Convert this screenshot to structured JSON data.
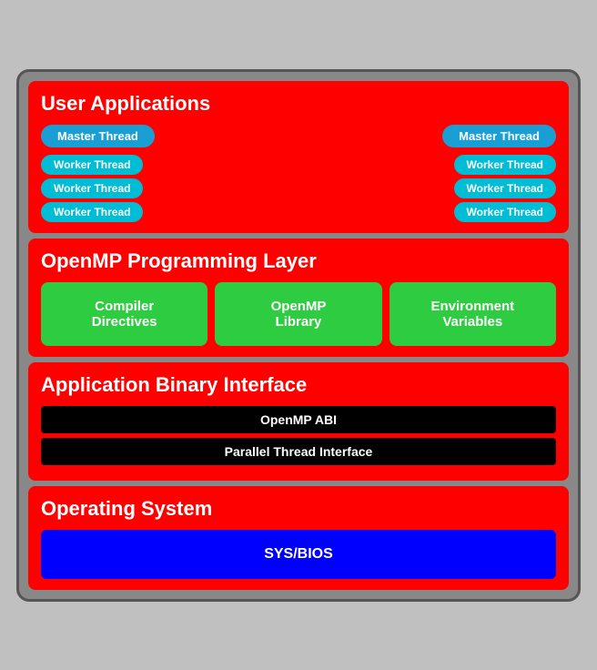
{
  "userApps": {
    "title": "User Applications",
    "masterThread1": "Master Thread",
    "masterThread2": "Master Thread",
    "workerThreads": {
      "left": [
        "Worker Thread",
        "Worker Thread",
        "Worker Thread"
      ],
      "right": [
        "Worker Thread",
        "Worker Thread",
        "Worker Thread"
      ]
    }
  },
  "openmp": {
    "title": "OpenMP Programming Layer",
    "boxes": [
      {
        "label": "Compiler\nDirectives"
      },
      {
        "label": "OpenMP\nLibrary"
      },
      {
        "label": "Environment\nVariables"
      }
    ]
  },
  "abi": {
    "title": "Application Binary Interface",
    "bar1": "OpenMP ABI",
    "bar2": "Parallel Thread Interface"
  },
  "os": {
    "title": "Operating System",
    "sysbios": "SYS/BIOS"
  }
}
